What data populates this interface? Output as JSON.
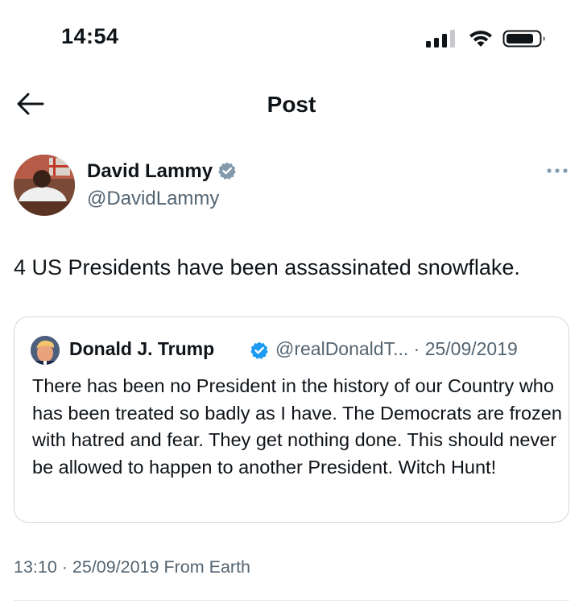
{
  "status_bar": {
    "time": "14:54",
    "icons": [
      "signal-icon",
      "wifi-icon",
      "battery-icon"
    ]
  },
  "nav": {
    "back_icon": "arrow-left-icon",
    "title": "Post"
  },
  "post": {
    "author": {
      "name": "David Lammy",
      "handle": "@DavidLammy",
      "verified": true
    },
    "text": "4 US Presidents have been assassinated snowflake.",
    "timestamp": "13:10 · 25/09/2019 From Earth"
  },
  "quoted_post": {
    "author": {
      "name": "Donald J. Trump",
      "verified": true
    },
    "meta": "@realDonaldT... · 25/09/2019",
    "text": "There has been no President in the history of our Country who has been treated so badly as I have. The Democrats are frozen with hatred and fear. They get nothing done. This should never be allowed to happen to another President. Witch Hunt!"
  },
  "colors": {
    "text_primary": "#0f1419",
    "text_secondary": "#536471",
    "verified_blue": "#1d9bf0",
    "verified_gray": "#829aab",
    "border": "#cfd9de"
  }
}
